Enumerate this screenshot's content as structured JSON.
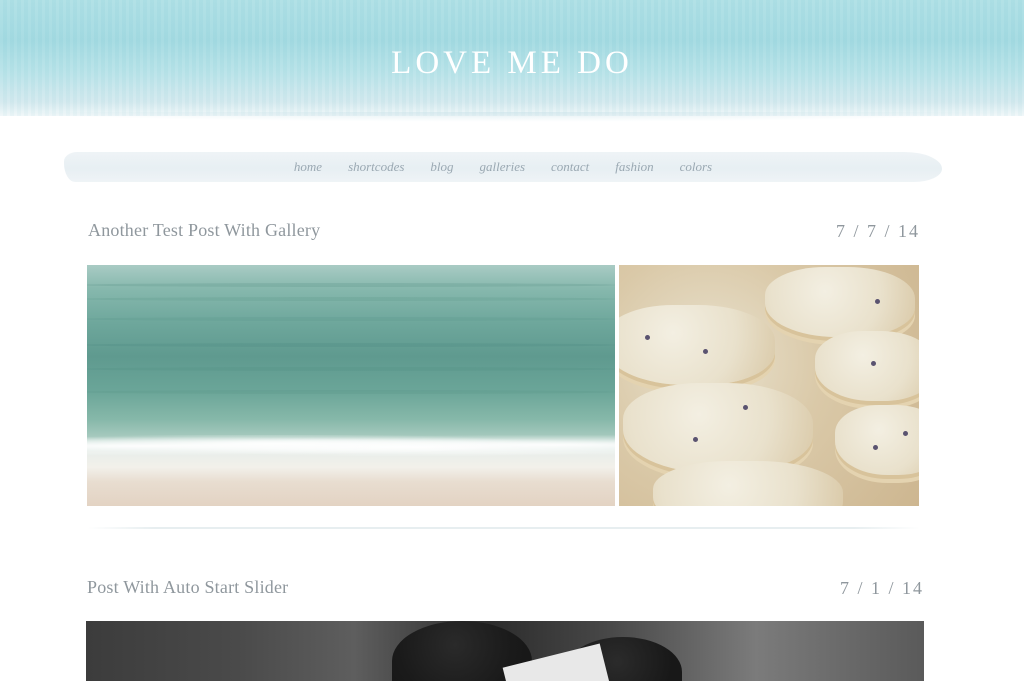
{
  "site": {
    "title": "LOVE ME DO"
  },
  "nav": {
    "items": [
      {
        "label": "home"
      },
      {
        "label": "shortcodes"
      },
      {
        "label": "blog"
      },
      {
        "label": "galleries"
      },
      {
        "label": "contact"
      },
      {
        "label": "fashion"
      },
      {
        "label": "colors"
      }
    ]
  },
  "posts": [
    {
      "title": "Another Test Post With Gallery",
      "date": "7 / 7 / 14",
      "images": [
        {
          "description": "sea-photo"
        },
        {
          "description": "cookies-photo"
        }
      ]
    },
    {
      "title": "Post With Auto Start Slider",
      "date": "7 / 1 / 14",
      "images": [
        {
          "description": "bw-couple-photo"
        }
      ]
    }
  ],
  "colors": {
    "header_band": "#a6dbe1",
    "text_muted": "#8f979d",
    "nav_text": "#9aa8b2",
    "nav_bg": "#e9f0f3"
  }
}
